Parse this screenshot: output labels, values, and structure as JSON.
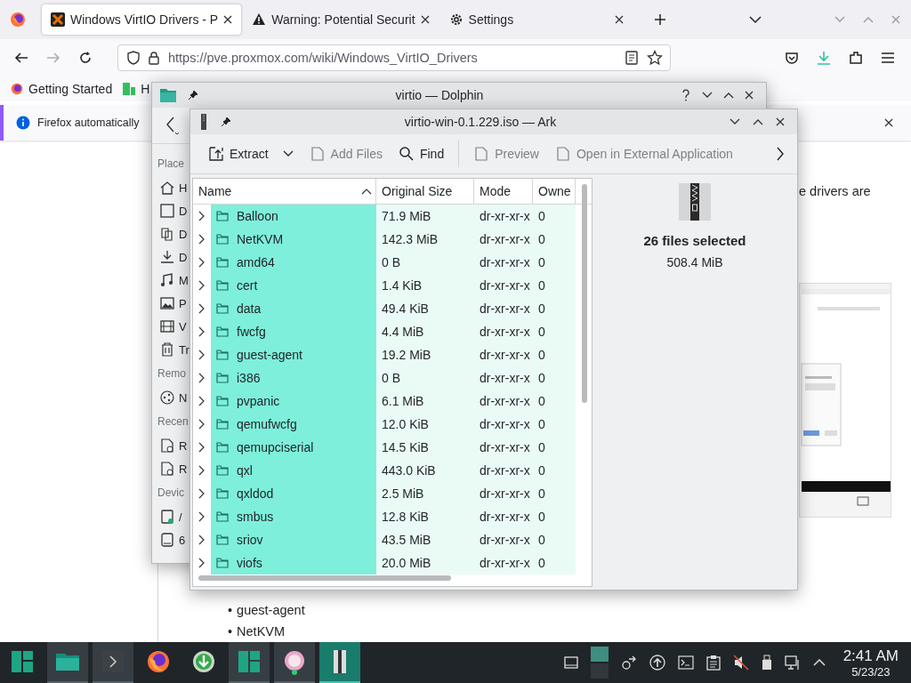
{
  "browser": {
    "tabs": [
      {
        "title": "Windows VirtIO Drivers - P",
        "selected": true
      },
      {
        "title": "Warning: Potential Securit",
        "selected": false
      },
      {
        "title": "Settings",
        "selected": false
      }
    ],
    "nav": {
      "forward_disabled": true
    },
    "url": "https://pve.proxmox.com/wiki/Windows_VirtIO_Drivers",
    "bookmarks": [
      "Getting Started",
      "H"
    ],
    "notification": "Firefox automatically",
    "page": {
      "text_fragment": "e drivers are",
      "list": [
        {
          "marker": "•",
          "text": "guest-agent"
        },
        {
          "marker": "•",
          "text": "NetKVM"
        }
      ]
    }
  },
  "dolphin": {
    "title": "virtio — Dolphin",
    "sidebar": [
      {
        "heading": "Place",
        "items": [
          "H",
          "D",
          "D",
          "D",
          "M",
          "P",
          "V",
          "Tr"
        ]
      },
      {
        "heading": "Remo",
        "items": [
          "N"
        ]
      },
      {
        "heading": "Recen",
        "items": [
          "R",
          "R"
        ]
      },
      {
        "heading": "Devic",
        "items": [
          "/",
          "6"
        ]
      }
    ]
  },
  "ark": {
    "title": "virtio-win-0.1.229.iso — Ark",
    "toolbar": [
      {
        "label": "Extract",
        "disabled": false
      },
      {
        "label": "Add Files",
        "disabled": true
      },
      {
        "label": "Find",
        "disabled": false
      },
      {
        "label": "Preview",
        "disabled": true
      },
      {
        "label": "Open in External Application",
        "disabled": true
      }
    ],
    "columns": [
      {
        "label": "Name",
        "sorted": true
      },
      {
        "label": "Original Size",
        "sorted": false
      },
      {
        "label": "Mode",
        "sorted": false
      },
      {
        "label": "Owne",
        "sorted": false
      }
    ],
    "rows": [
      {
        "name": "Balloon",
        "size": "71.9 MiB",
        "mode": "dr-xr-xr-x",
        "owner": "0",
        "selected": true
      },
      {
        "name": "NetKVM",
        "size": "142.3 MiB",
        "mode": "dr-xr-xr-x",
        "owner": "0",
        "selected": true
      },
      {
        "name": "amd64",
        "size": "0 B",
        "mode": "dr-xr-xr-x",
        "owner": "0",
        "selected": true
      },
      {
        "name": "cert",
        "size": "1.4 KiB",
        "mode": "dr-xr-xr-x",
        "owner": "0",
        "selected": true
      },
      {
        "name": "data",
        "size": "49.4 KiB",
        "mode": "dr-xr-xr-x",
        "owner": "0",
        "selected": true
      },
      {
        "name": "fwcfg",
        "size": "4.4 MiB",
        "mode": "dr-xr-xr-x",
        "owner": "0",
        "selected": true
      },
      {
        "name": "guest-agent",
        "size": "19.2 MiB",
        "mode": "dr-xr-xr-x",
        "owner": "0",
        "selected": true
      },
      {
        "name": "i386",
        "size": "0 B",
        "mode": "dr-xr-xr-x",
        "owner": "0",
        "selected": true
      },
      {
        "name": "pvpanic",
        "size": "6.1 MiB",
        "mode": "dr-xr-xr-x",
        "owner": "0",
        "selected": true
      },
      {
        "name": "qemufwcfg",
        "size": "12.0 KiB",
        "mode": "dr-xr-xr-x",
        "owner": "0",
        "selected": true
      },
      {
        "name": "qemupciserial",
        "size": "14.5 KiB",
        "mode": "dr-xr-xr-x",
        "owner": "0",
        "selected": true
      },
      {
        "name": "qxl",
        "size": "443.0 KiB",
        "mode": "dr-xr-xr-x",
        "owner": "0",
        "selected": true
      },
      {
        "name": "qxldod",
        "size": "2.5 MiB",
        "mode": "dr-xr-xr-x",
        "owner": "0",
        "selected": true
      },
      {
        "name": "smbus",
        "size": "12.8 KiB",
        "mode": "dr-xr-xr-x",
        "owner": "0",
        "selected": true
      },
      {
        "name": "sriov",
        "size": "43.5 MiB",
        "mode": "dr-xr-xr-x",
        "owner": "0",
        "selected": true
      },
      {
        "name": "viofs",
        "size": "20.0 MiB",
        "mode": "dr-xr-xr-x",
        "owner": "0",
        "selected": true
      }
    ],
    "info": {
      "title": "26 files selected",
      "size": "508.4 MiB"
    }
  },
  "taskbar": {
    "tasks": [
      {
        "open": false,
        "focused": false
      },
      {
        "open": true,
        "focused": false
      },
      {
        "open": true,
        "focused": false
      },
      {
        "open": false,
        "focused": false
      },
      {
        "open": false,
        "focused": false
      },
      {
        "open": true,
        "focused": false
      },
      {
        "open": true,
        "focused": false
      },
      {
        "open": true,
        "focused": true
      }
    ],
    "clock": {
      "time": "2:41 AM",
      "date": "5/23/23"
    }
  }
}
